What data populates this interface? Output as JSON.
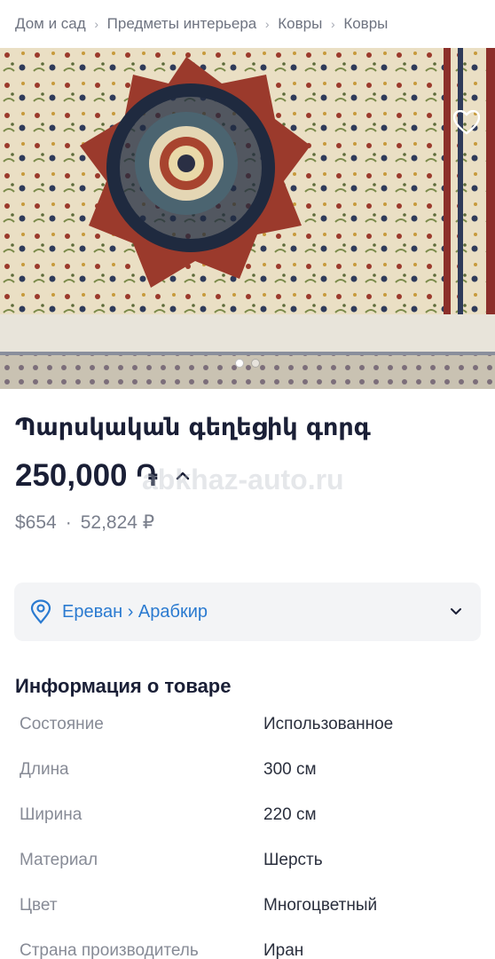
{
  "breadcrumb": {
    "items": [
      "Дом и сад",
      "Предметы интерьера",
      "Ковры",
      "Ковры"
    ]
  },
  "gallery": {
    "favorite_icon": "heart-icon",
    "slide_count": 2,
    "active_slide": 1
  },
  "listing": {
    "title": "Պարսկական գեղեցիկ գորգ",
    "price": "250,000",
    "currency": "֏",
    "usd_price": "$654",
    "rub_price": "52,824 ₽",
    "watermark": "abkhaz-auto.ru"
  },
  "location": {
    "icon": "map-pin-icon",
    "text": "Ереван › Арабкир"
  },
  "info": {
    "title": "Информация о товаре",
    "rows": [
      {
        "label": "Состояние",
        "value": "Использованное"
      },
      {
        "label": "Длина",
        "value": "300 см"
      },
      {
        "label": "Ширина",
        "value": "220 см"
      },
      {
        "label": "Материал",
        "value": "Шерсть"
      },
      {
        "label": "Цвет",
        "value": "Многоцветный"
      },
      {
        "label": "Страна производитель",
        "value": "Иран"
      }
    ]
  },
  "colors": {
    "accent": "#2a7ad0",
    "text_primary": "#1a1f36",
    "text_secondary": "#878b96"
  }
}
